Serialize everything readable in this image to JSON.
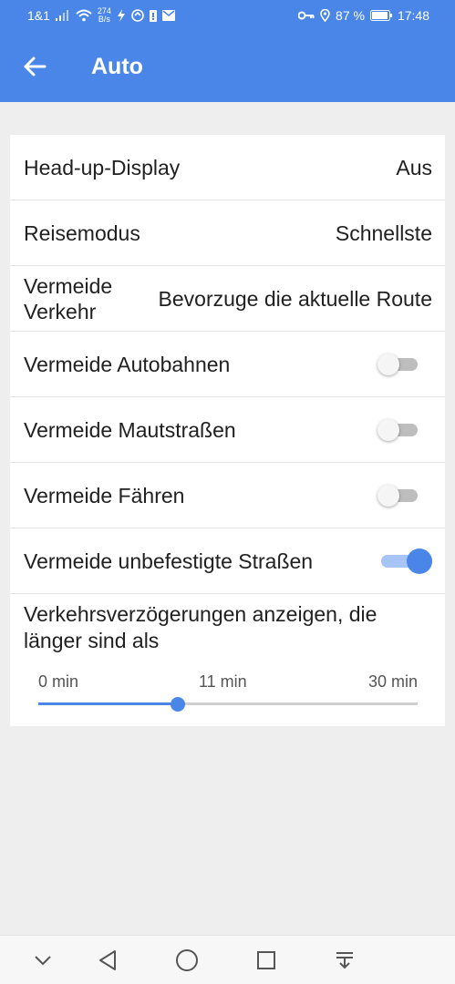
{
  "status_bar": {
    "carrier": "1&1",
    "data_rate_value": "274",
    "data_rate_unit": "B/s",
    "battery": "87 %",
    "time": "17:48"
  },
  "appbar": {
    "title": "Auto"
  },
  "settings": {
    "head_up_display": {
      "label": "Head-up-Display",
      "value": "Aus"
    },
    "travel_mode": {
      "label": "Reisemodus",
      "value": "Schnellste"
    },
    "avoid_traffic": {
      "label": "Vermeide Verkehr",
      "value": "Bevorzuge die aktuelle Route"
    },
    "toggles": [
      {
        "label": "Vermeide Autobahnen",
        "on": false
      },
      {
        "label": "Vermeide Mautstraßen",
        "on": false
      },
      {
        "label": "Vermeide Fähren",
        "on": false
      },
      {
        "label": "Vermeide unbefestigte Straßen",
        "on": true
      }
    ],
    "delay": {
      "label": "Verkehrsverzögerungen anzeigen, die länger sind als",
      "min_label": "0 min",
      "current_label": "11 min",
      "max_label": "30 min",
      "min": 0,
      "max": 30,
      "value": 11
    }
  },
  "colors": {
    "accent": "#4a86e8",
    "background": "#eeeeee"
  }
}
